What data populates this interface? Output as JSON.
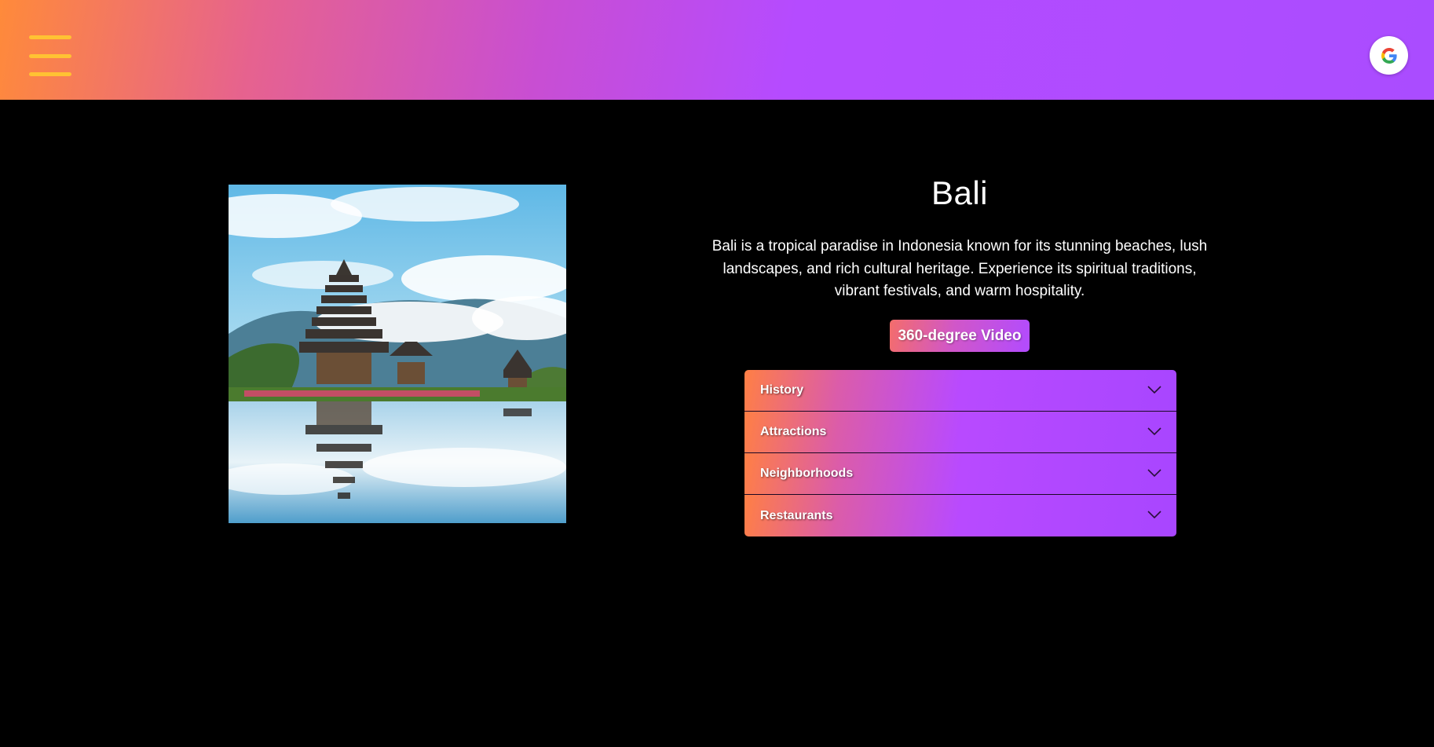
{
  "header": {
    "menu_icon": "hamburger-menu-icon",
    "account_icon": "google-icon",
    "accent_color": "#b54bff",
    "menu_color": "#ffc233"
  },
  "destination": {
    "image_subject": "Ulun Danu Beratan temple reflected in Lake Beratan",
    "title": "Bali",
    "description": "Bali is a tropical paradise in Indonesia known for its stunning beaches, lush landscapes, and rich cultural heritage. Experience its spiritual traditions, vibrant festivals, and warm hospitality.",
    "video_button_label": "360-degree Video"
  },
  "accordion": {
    "items": [
      {
        "label": "History",
        "icon": "chevron-down-icon"
      },
      {
        "label": "Attractions",
        "icon": "chevron-down-icon"
      },
      {
        "label": "Neighborhoods",
        "icon": "chevron-down-icon"
      },
      {
        "label": "Restaurants",
        "icon": "chevron-down-icon"
      }
    ]
  }
}
